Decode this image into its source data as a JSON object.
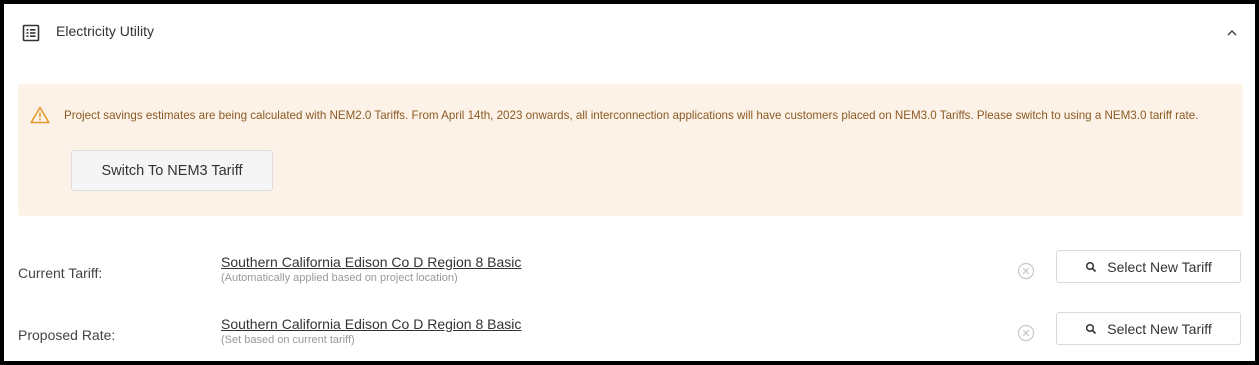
{
  "header": {
    "title": "Electricity Utility",
    "icon": "list-icon",
    "toggle_icon": "chevron-up-icon"
  },
  "alert": {
    "icon": "warning-triangle-icon",
    "message": "Project savings estimates are being calculated with NEM2.0 Tariffs. From April 14th, 2023 onwards, all interconnection applications will have customers placed on NEM3.0 Tariffs. Please switch to using a NEM3.0 tariff rate.",
    "button_label": "Switch To NEM3 Tariff",
    "color": "#8a5a22",
    "background": "#fdf2e8"
  },
  "rows": [
    {
      "label": "Current Tariff:",
      "tariff": "Southern California Edison Co D Region 8 Basic",
      "note": "(Automatically applied based on project location)",
      "button_label": "Select New Tariff"
    },
    {
      "label": "Proposed Rate:",
      "tariff": "Southern California Edison Co D Region 8 Basic",
      "note": "(Set based on current tariff)",
      "button_label": "Select New Tariff"
    }
  ]
}
